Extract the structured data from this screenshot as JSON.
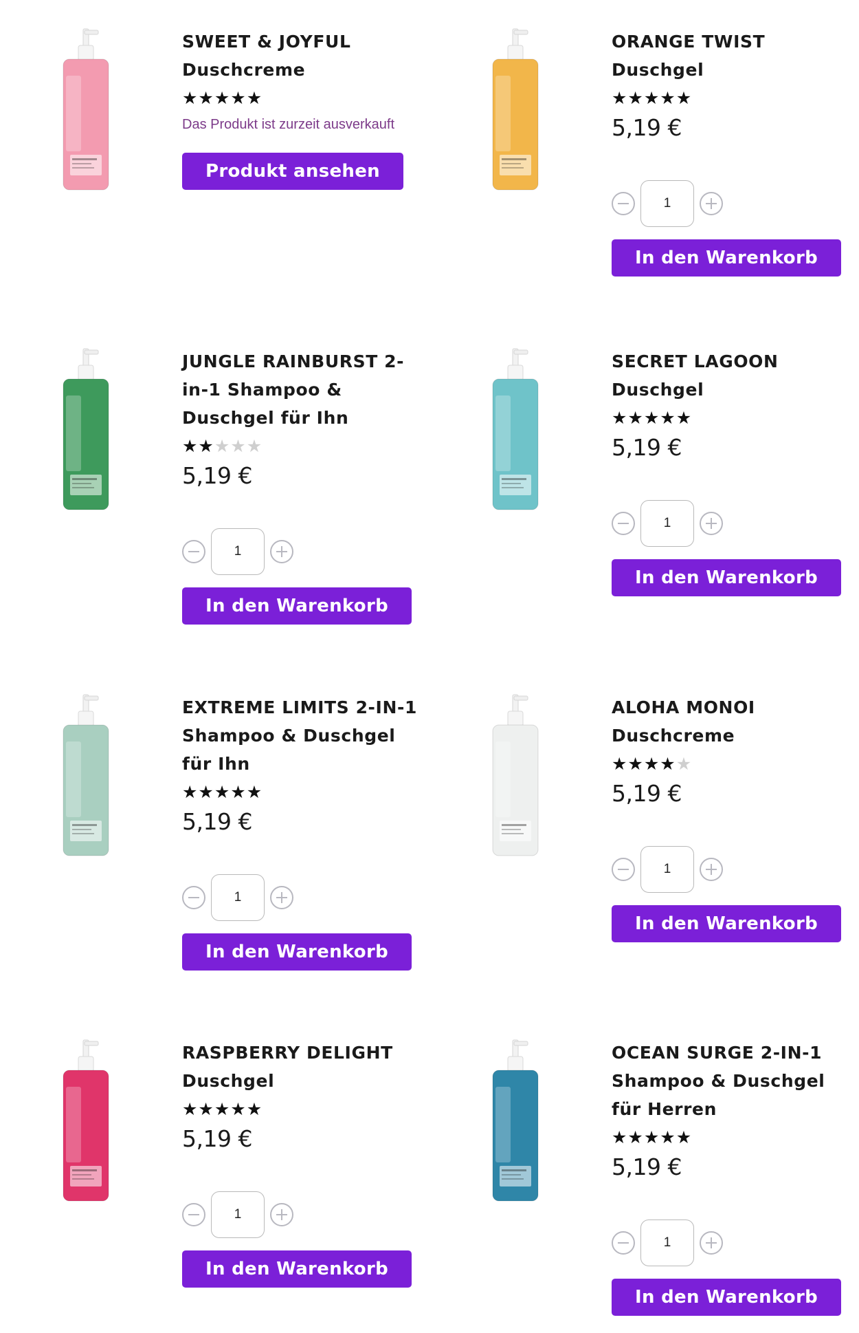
{
  "colors": {
    "accent": "#7b20d8",
    "soldout_text": "#7c3a89",
    "star_on": "#111111",
    "star_off": "#cfcfcf"
  },
  "products": [
    {
      "title_upper": "SWEET & JOYFUL",
      "title_rest": "Duschcreme",
      "rating": 5,
      "soldout_text": "Das Produkt ist zurzeit ausverkauft",
      "button_label": "Produkt ansehen",
      "bottle_color": "#f39bb0"
    },
    {
      "title_upper": "ORANGE TWIST",
      "title_rest": "Duschgel",
      "rating": 4.5,
      "price": "5,19 €",
      "quantity": "1",
      "button_label": "In den Warenkorb",
      "bottle_color": "#f2b64a"
    },
    {
      "title_upper": "JUNGLE RAINBURST 2-",
      "title_rest": "in-1 Shampoo & Duschgel für Ihn",
      "rating": 2,
      "price": "5,19 €",
      "quantity": "1",
      "button_label": "In den Warenkorb",
      "bottle_color": "#3e9a5c"
    },
    {
      "title_upper": "SECRET LAGOON",
      "title_rest": "Duschgel",
      "rating": 5,
      "price": "5,19 €",
      "quantity": "1",
      "button_label": "In den Warenkorb",
      "bottle_color": "#6fc3c9"
    },
    {
      "title_upper": "EXTREME LIMITS 2-in-1",
      "title_rest": "Shampoo & Duschgel für Ihn",
      "rating": 5,
      "price": "5,19 €",
      "quantity": "1",
      "button_label": "In den Warenkorb",
      "bottle_color": "#a9cfc0"
    },
    {
      "title_upper": "ALOHA MONOI",
      "title_rest": "Duschcreme",
      "rating": 4,
      "price": "5,19 €",
      "quantity": "1",
      "button_label": "In den Warenkorb",
      "bottle_color": "#eef0ef"
    },
    {
      "title_upper": "RASPBERRY DELIGHT",
      "title_rest": "Duschgel",
      "rating": 5,
      "price": "5,19 €",
      "quantity": "1",
      "button_label": "In den Warenkorb",
      "bottle_color": "#e0356a"
    },
    {
      "title_upper": "OCEAN SURGE 2-in-1",
      "title_rest": "Shampoo & Duschgel für Herren",
      "rating": 5,
      "price": "5,19 €",
      "quantity": "1",
      "button_label": "In den Warenkorb",
      "bottle_color": "#2f86a8"
    }
  ]
}
